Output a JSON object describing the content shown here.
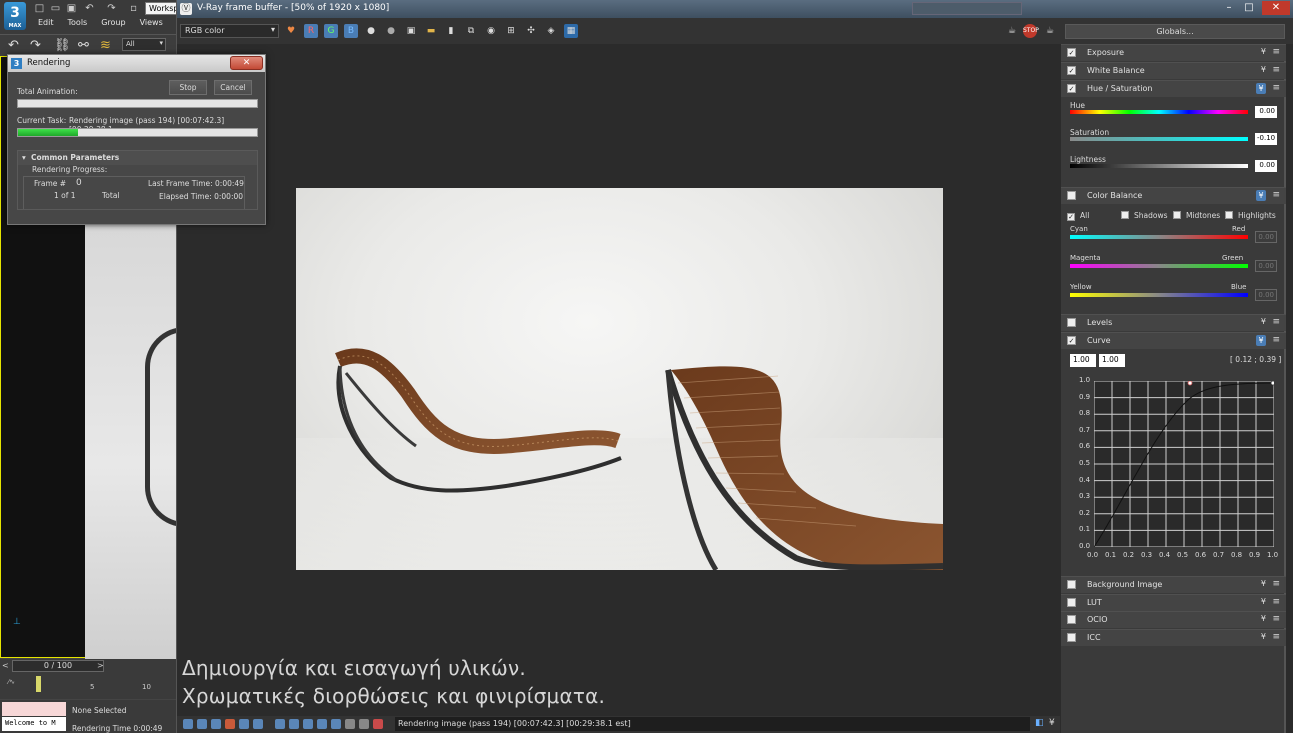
{
  "max": {
    "logo_text": "3",
    "logo_sub": "MAX",
    "workspace": "Worksp",
    "menus": [
      "Edit",
      "Tools",
      "Group",
      "Views"
    ],
    "selection_filter": "All",
    "time_slider": "0 / 100",
    "track_ticks": [
      "5",
      "10"
    ],
    "selection_status": "None Selected",
    "render_time": "Rendering Time  0:00:49",
    "maxscript_listener": "Welcome to M"
  },
  "vfb": {
    "title": "V-Ray frame buffer - [50% of 1920 x 1080]",
    "channel": "RGB color",
    "channel_buttons": [
      "R",
      "G",
      "B"
    ],
    "globals_label": "Globals...",
    "status_text": "Rendering image (pass 194) [00:07:42.3] [00:29:38.1 est]",
    "captions": [
      "Δημιουργία και εισαγωγή υλικών.",
      "Χρωματικές διορθώσεις και φινιρίσματα."
    ]
  },
  "cc_panel": {
    "sections": {
      "exposure": "Exposure",
      "white_balance": "White Balance",
      "hue_saturation": "Hue / Saturation",
      "color_balance": "Color Balance",
      "levels": "Levels",
      "curve": "Curve",
      "background_image": "Background Image",
      "lut": "LUT",
      "ocio": "OCIO",
      "icc": "ICC"
    },
    "hue": {
      "label": "Hue",
      "value": "0.00"
    },
    "saturation": {
      "label": "Saturation",
      "value": "-0.10"
    },
    "lightness": {
      "label": "Lightness",
      "value": "0.00"
    },
    "color_balance_options": [
      "All",
      "Shadows",
      "Midtones",
      "Highlights"
    ],
    "cyan_red": {
      "left": "Cyan",
      "right": "Red",
      "value": "0.00"
    },
    "magenta_green": {
      "left": "Magenta",
      "right": "Green",
      "value": "0.00"
    },
    "yellow_blue": {
      "left": "Yellow",
      "right": "Blue",
      "value": "0.00"
    },
    "curve": {
      "input_a": "1.00",
      "input_b": "1.00",
      "coords": "[ 0.12 ; 0.39 ]",
      "y_ticks": [
        "1.0",
        "0.9",
        "0.8",
        "0.7",
        "0.6",
        "0.5",
        "0.4",
        "0.3",
        "0.2",
        "0.1",
        "0.0"
      ],
      "x_ticks": [
        "0.0",
        "0.1",
        "0.2",
        "0.3",
        "0.4",
        "0.5",
        "0.6",
        "0.7",
        "0.8",
        "0.9",
        "1.0"
      ]
    }
  },
  "render_dialog": {
    "title": "Rendering",
    "close_label": "✕",
    "stop_label": "Stop",
    "cancel_label": "Cancel",
    "total_animation_label": "Total Animation:",
    "current_task_label": "Current Task:",
    "current_task_value": "Rendering image (pass 194) [00:07:42.3] [00:29:38.1",
    "total_progress": 0.0,
    "task_progress": 0.25,
    "common_params": "Common Parameters",
    "render_progress": "Rendering Progress:",
    "frame_label": "Frame #",
    "frame_value": "0",
    "of_label": "1 of 1",
    "total_label": "Total",
    "last_frame_time": "Last Frame Time:  0:00:49",
    "elapsed_time": "Elapsed Time:  0:00:00"
  }
}
